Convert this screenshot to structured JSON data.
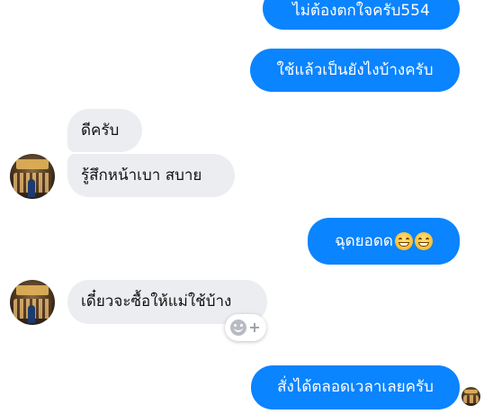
{
  "messages": [
    {
      "side": "outgoing",
      "text": "ไม่ต้องตกใจครับ554"
    },
    {
      "side": "outgoing",
      "text": "ใช้แล้วเป็นยังไงบ้างครับ"
    },
    {
      "side": "incoming",
      "text": "ดีครับ"
    },
    {
      "side": "incoming",
      "text": "รู้สึกหน้าเบา สบาย"
    },
    {
      "side": "outgoing",
      "text": "ฉุดยอดด",
      "emojis": [
        "grinning-face-icon",
        "laughing-face-icon"
      ]
    },
    {
      "side": "incoming",
      "text": "เดี๋ยวจะซื้อให้แม่ใช้บ้าง"
    },
    {
      "side": "outgoing",
      "text": "สั่งได้ตลอดเวลาเลยครับ"
    }
  ],
  "colors": {
    "outgoing_bubble": "#0a84ff",
    "incoming_bubble": "#ecedf0",
    "background": "#ffffff"
  },
  "reaction_button": {
    "icon": "add-reaction-icon"
  }
}
